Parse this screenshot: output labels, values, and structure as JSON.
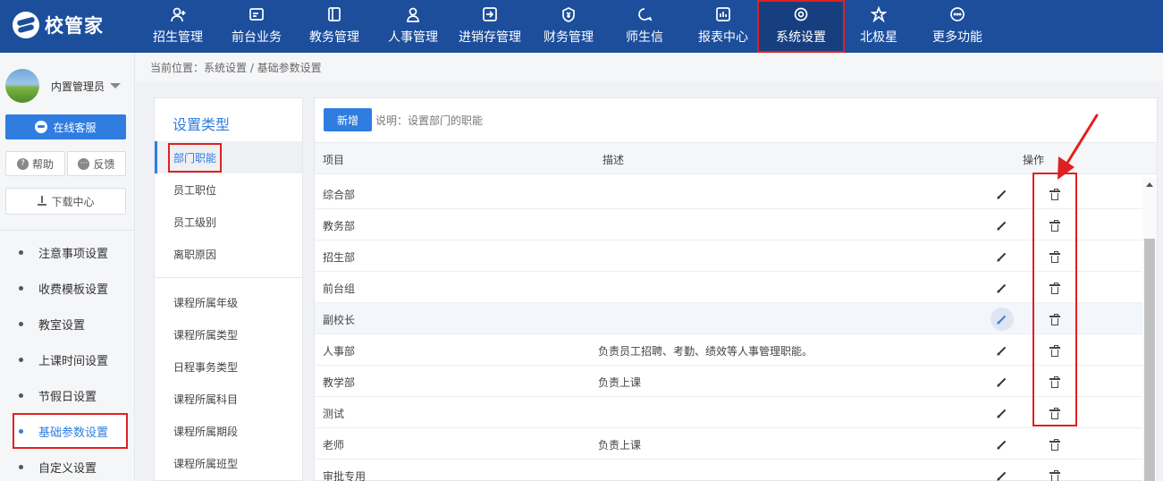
{
  "app": {
    "logo_text": "校管家"
  },
  "nav": [
    {
      "label": "招生管理",
      "icon": "user-add-icon"
    },
    {
      "label": "前台业务",
      "icon": "monitor-icon"
    },
    {
      "label": "教务管理",
      "icon": "book-icon"
    },
    {
      "label": "人事管理",
      "icon": "person-icon"
    },
    {
      "label": "进销存管理",
      "icon": "inventory-icon"
    },
    {
      "label": "财务管理",
      "icon": "yuan-shield-icon"
    },
    {
      "label": "师生信",
      "icon": "chat-icon"
    },
    {
      "label": "报表中心",
      "icon": "chart-icon"
    },
    {
      "label": "系统设置",
      "icon": "settings-icon",
      "active": true
    },
    {
      "label": "北极星",
      "icon": "star-icon"
    },
    {
      "label": "更多功能",
      "icon": "more-icon"
    }
  ],
  "sidebar": {
    "user_name": "内置管理员",
    "service_label": "在线客服",
    "help_label": "帮助",
    "feedback_label": "反馈",
    "download_label": "下载中心",
    "menu": [
      {
        "label": "注意事项设置"
      },
      {
        "label": "收费模板设置"
      },
      {
        "label": "教室设置"
      },
      {
        "label": "上课时间设置"
      },
      {
        "label": "节假日设置"
      },
      {
        "label": "基础参数设置",
        "active": true
      },
      {
        "label": "自定义设置"
      }
    ]
  },
  "breadcrumb": "当前位置：系统设置 / 基础参数设置",
  "settings_type": {
    "title": "设置类型",
    "group1": [
      "部门职能",
      "员工职位",
      "员工级别",
      "离职原因"
    ],
    "group2": [
      "课程所属年级",
      "课程所属类型",
      "日程事务类型",
      "课程所属科目",
      "课程所属期段",
      "课程所属班型"
    ]
  },
  "main": {
    "add_label": "新增",
    "note": "说明：设置部门的职能",
    "columns": {
      "item": "项目",
      "desc": "描述",
      "ops": "操作"
    },
    "rows": [
      {
        "item": "综合部",
        "desc": ""
      },
      {
        "item": "教务部",
        "desc": ""
      },
      {
        "item": "招生部",
        "desc": ""
      },
      {
        "item": "前台组",
        "desc": ""
      },
      {
        "item": "副校长",
        "desc": ""
      },
      {
        "item": "人事部",
        "desc": "负责员工招聘、考勤、绩效等人事管理职能。"
      },
      {
        "item": "教学部",
        "desc": "负责上课"
      },
      {
        "item": "测试",
        "desc": ""
      },
      {
        "item": "老师",
        "desc": "负责上课"
      },
      {
        "item": "审批专用",
        "desc": ""
      }
    ],
    "hover_row": 4
  },
  "colors": {
    "nav_bg": "#1c4e9c",
    "accent": "#2f7de1",
    "annotation": "#e02020"
  }
}
